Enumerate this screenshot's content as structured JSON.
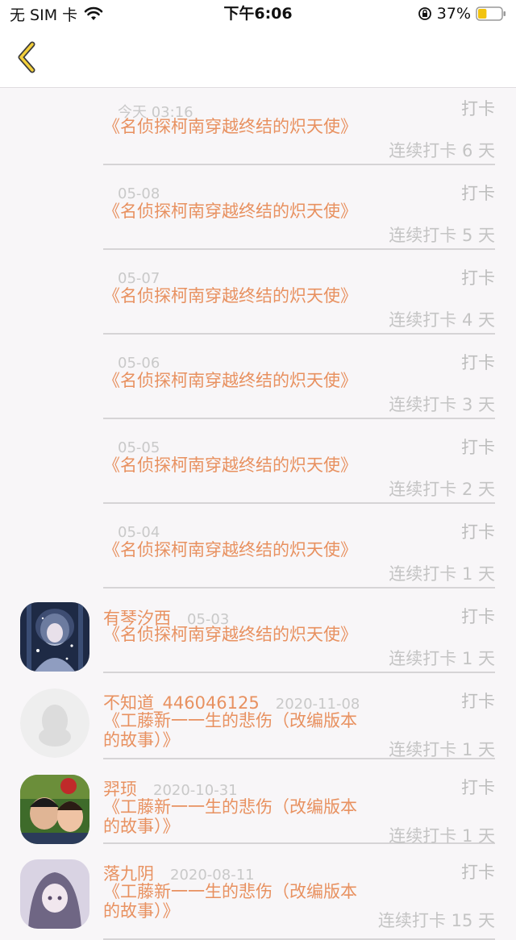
{
  "status_bar": {
    "carrier": "无 SIM 卡",
    "time": "下午6:06",
    "battery": "37%",
    "battery_level": 0.37
  },
  "nav": {
    "back_icon": "chevron-left-icon"
  },
  "entries": [
    {
      "name": "",
      "date": "今天 03:16",
      "title": "《名侦探柯南穿越终结的炽天使》",
      "action": "打卡",
      "streak": "连续打卡 6 天",
      "avatar": null
    },
    {
      "name": "",
      "date": "05-08",
      "title": "《名侦探柯南穿越终结的炽天使》",
      "action": "打卡",
      "streak": "连续打卡 5 天",
      "avatar": null
    },
    {
      "name": "",
      "date": "05-07",
      "title": "《名侦探柯南穿越终结的炽天使》",
      "action": "打卡",
      "streak": "连续打卡 4 天",
      "avatar": null
    },
    {
      "name": "",
      "date": "05-06",
      "title": "《名侦探柯南穿越终结的炽天使》",
      "action": "打卡",
      "streak": "连续打卡 3 天",
      "avatar": null
    },
    {
      "name": "",
      "date": "05-05",
      "title": "《名侦探柯南穿越终结的炽天使》",
      "action": "打卡",
      "streak": "连续打卡 2 天",
      "avatar": null
    },
    {
      "name": "",
      "date": "05-04",
      "title": "《名侦探柯南穿越终结的炽天使》",
      "action": "打卡",
      "streak": "连续打卡 1 天",
      "avatar": null
    },
    {
      "name": "有琴汐西",
      "date": "05-03",
      "title": "《名侦探柯南穿越终结的炽天使》",
      "action": "打卡",
      "streak": "连续打卡 1 天",
      "avatar": "anime-girl-avatar"
    },
    {
      "name": "不知道_446046125",
      "date": "2020-11-08",
      "title": "《工藤新一一生的悲伤（改编版本的故事）》",
      "action": "打卡",
      "streak": "连续打卡 1 天",
      "avatar": "default-penguin-avatar"
    },
    {
      "name": "羿顼",
      "date": "2020-10-31",
      "title": "《工藤新一一生的悲伤（改编版本的故事）》",
      "action": "打卡",
      "streak": "连续打卡 1 天",
      "avatar": "children-photo-avatar"
    },
    {
      "name": "落九阴",
      "date": "2020-08-11",
      "title": "《工藤新一一生的悲伤（改编版本的故事）》",
      "action": "打卡",
      "streak": "连续打卡 15 天",
      "avatar": "anime-sketch-avatar"
    }
  ],
  "colors": {
    "accent": "#e89160",
    "muted": "#c9c9c9",
    "background": "#f8f6f8"
  }
}
